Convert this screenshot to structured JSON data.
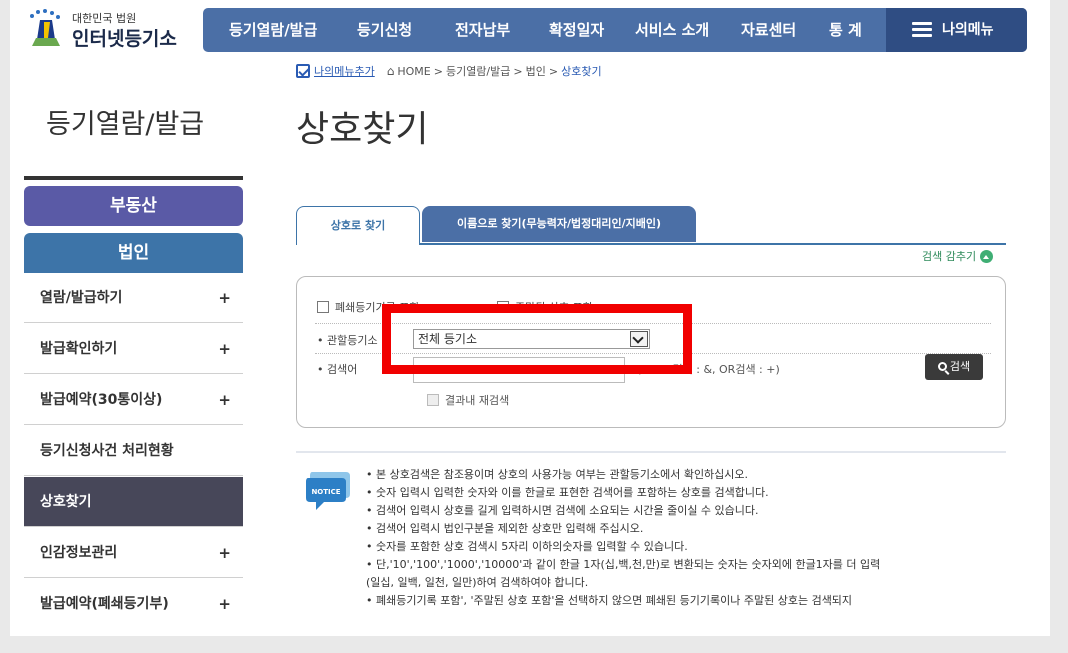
{
  "logo": {
    "small": "대한민국 법원",
    "big": "인터넷등기소"
  },
  "gnb": {
    "items": [
      "등기열람/발급",
      "등기신청",
      "전자납부",
      "확정일자",
      "서비스 소개",
      "자료센터",
      "통 계"
    ],
    "my_menu": "나의메뉴"
  },
  "breadcrumb": {
    "add_menu": "나의메뉴추가",
    "home": "HOME",
    "sep": ">",
    "path1": "등기열람/발급",
    "path2": "법인",
    "current": "상호찾기"
  },
  "section_title": "등기열람/발급",
  "lnb": {
    "real_estate": "부동산",
    "corp": "법인",
    "items": [
      {
        "label": "열람/발급하기",
        "plus": "+"
      },
      {
        "label": "발급확인하기",
        "plus": "+"
      },
      {
        "label": "발급예약(30통이상)",
        "plus": "+"
      },
      {
        "label": "등기신청사건 처리현황",
        "plus": ""
      },
      {
        "label": "상호찾기",
        "plus": ""
      },
      {
        "label": "인감정보관리",
        "plus": "+"
      },
      {
        "label": "발급예약(폐쇄등기부)",
        "plus": "+"
      }
    ]
  },
  "page_title": "상호찾기",
  "tabs": {
    "tab1": "상호로 찾기",
    "tab2": "이름으로 찾기(무능력자/법정대리인/지배인)"
  },
  "collapse_label": "검색 감추기",
  "search": {
    "opt1_label": "폐쇄등기기록 포함",
    "opt2_label": "주말된 상호 포함",
    "office_label": "• 관할등기소",
    "office_value": "전체 등기소",
    "keyword_label": "• 검색어",
    "keyword_value": "",
    "hint": "( AND 검색 : &, OR검색 : +)",
    "search_btn": "검색",
    "research_label": "결과내 재검색"
  },
  "notice": {
    "icon_text": "NOTICE",
    "lines": [
      "• 본 상호검색은 참조용이며 상호의 사용가능 여부는 관할등기소에서 확인하십시오.",
      "• 숫자 입력시 입력한 숫자와 이를 한글로 표현한 검색어를 포함하는 상호를 검색합니다.",
      "• 검색어 입력시 상호를 길게 입력하시면 검색에 소요되는 시간을 줄이실 수 있습니다.",
      "• 검색어 입력시 법인구분을 제외한 상호만 입력해 주십시오.",
      "• 숫자를 포함한 상호 검색시 5자리 이하의숫자를 입력할 수 있습니다.",
      "• 단,'10','100','1000','10000'과 같이 한글 1자(십,백,천,만)로 변환되는 숫자는 숫자외에 한글1자를 더 입력",
      "   (일십, 일백, 일천, 일만)하여 검색하여야 합니다.",
      "• 폐쇄등기기록 포함', '주말된 상호 포함'을 선택하지 않으면 폐쇄된 등기기록이나 주말된 상호는 검색되지"
    ]
  }
}
